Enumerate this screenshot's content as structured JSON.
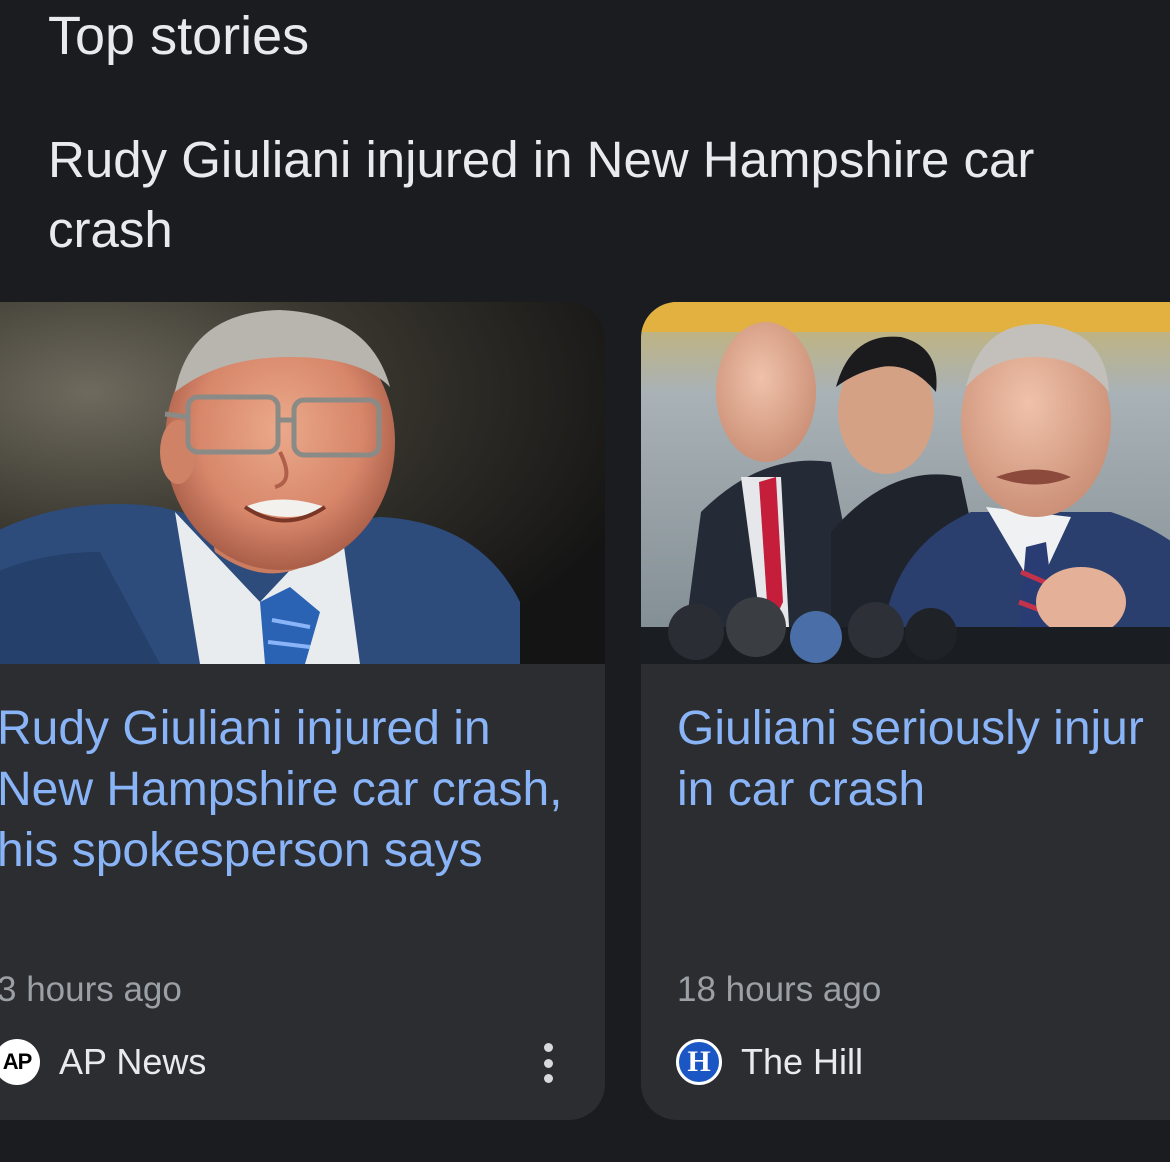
{
  "section": {
    "title": "Top stories"
  },
  "cluster": {
    "headline": "Rudy Giuliani injured in New Hampshire car crash"
  },
  "stories": [
    {
      "title": "Rudy Giuliani injured in New Hampshire car crash, his spokesperson says",
      "time": "3 hours ago",
      "source_name": "AP News",
      "source_logo_text": "AP",
      "menu_icon": "more-vertical-icon"
    },
    {
      "title_line1": "Giuliani seriously injur",
      "title_line2": "in car crash",
      "time": "18 hours ago",
      "source_name": "The Hill",
      "source_logo_text": "H"
    }
  ],
  "colors": {
    "background": "#1b1c1f",
    "card": "#2c2d30",
    "link": "#8ab4f8",
    "meta": "#9aa0a6",
    "text": "#e8eaed"
  }
}
